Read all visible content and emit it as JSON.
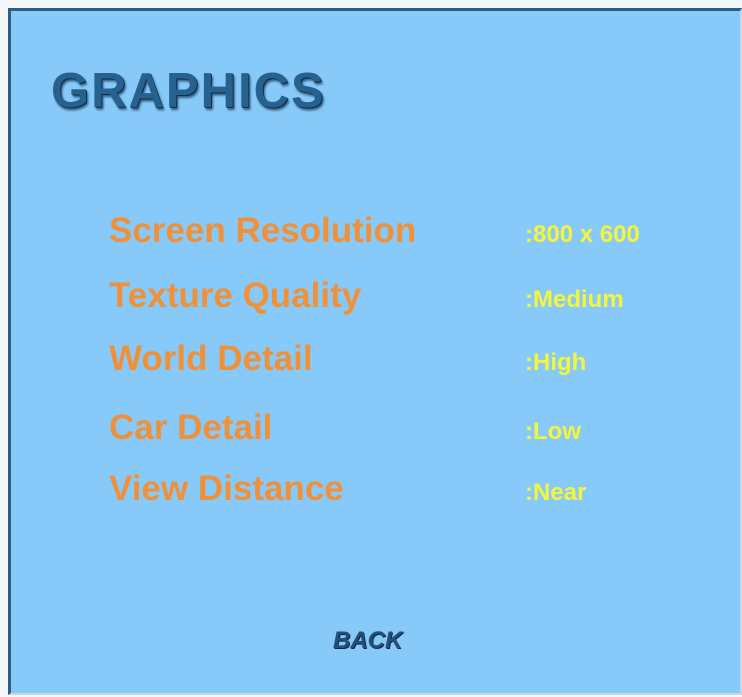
{
  "menu": {
    "title": "GRAPHICS",
    "settings": [
      {
        "label": "Screen Resolution",
        "value": ":800 x 600"
      },
      {
        "label": "Texture Quality",
        "value": ":Medium"
      },
      {
        "label": "World Detail",
        "value": ":High"
      },
      {
        "label": "Car Detail",
        "value": ":Low"
      },
      {
        "label": "View Distance",
        "value": ":Near"
      }
    ],
    "back_label": "BACK"
  },
  "colors": {
    "background": "#87c9f8",
    "title": "#27618f",
    "setting_label": "#f0913a",
    "setting_value": "#f5f53a",
    "back": "#244f78"
  }
}
